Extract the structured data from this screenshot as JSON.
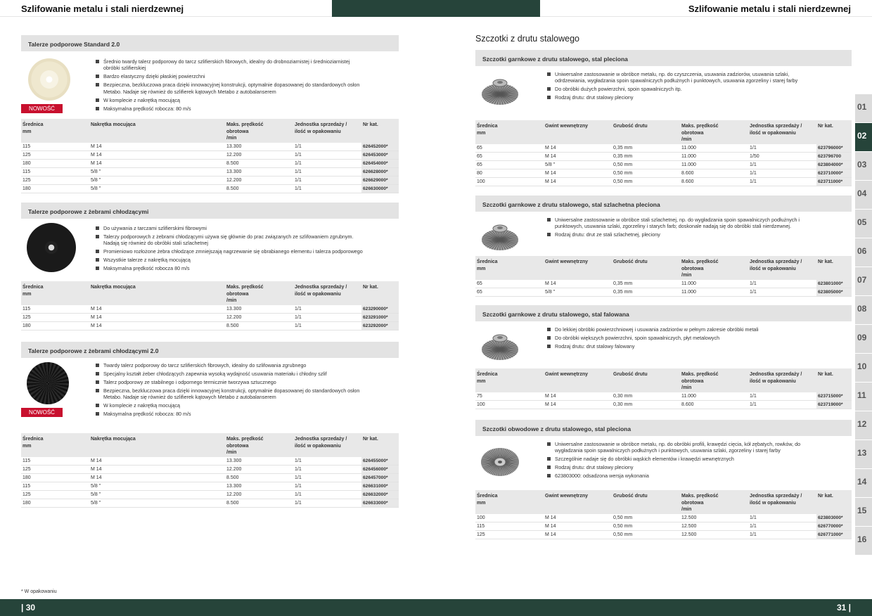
{
  "header": {
    "left_title": "Szlifowanie metalu i stali nierdzewnej",
    "right_title": "Szlifowanie metalu i stali nierdzewnej"
  },
  "badge": "NOWOŚĆ",
  "left_cols": [
    "Średnica\nmm",
    "Nakrętka mocująca",
    "Maks. prędkość\nobrotowa\n/min",
    "Jednostka sprzedaży /\nilość w opakowaniu",
    "Nr kat."
  ],
  "right_cols": [
    "Średnica\nmm",
    "Gwint wewnętrzny",
    "Grubość drutu",
    "Maks. prędkość\nobrotowa\n/min",
    "Jednostka sprzedaży /\nilość w opakowaniu",
    "Nr kat."
  ],
  "left_sections": [
    {
      "title": "Talerze podporowe Standard 2.0",
      "bullets": [
        "Średnio twardy talerz podporowy do tarcz szlifierskich fibrowych, idealny do drobnoziarnistej i średnioziarnistej obróbki szlifierskiej",
        "Bardzo elastyczny dzięki płaskiej powierzchni",
        "Bezpieczna, bezkluczowa praca dzięki innowacyjnej konstrukcji, optymalnie dopasowanej do standardowych osłon Metabo. Nadaje się również do szlifierek kątowych Metabo z autobalanserem",
        "W komplecie z nakrętką mocującą",
        "Maksymalna prędkość robocza: 80 m/s"
      ],
      "rows": [
        [
          "115",
          "M 14",
          "13.300",
          "1/1",
          "626452000*"
        ],
        [
          "125",
          "M 14",
          "12.200",
          "1/1",
          "626453000*"
        ],
        [
          "180",
          "M 14",
          "8.500",
          "1/1",
          "626454000*"
        ],
        [
          "115",
          "5/8 \"",
          "13.300",
          "1/1",
          "626628000*"
        ],
        [
          "125",
          "5/8 \"",
          "12.200",
          "1/1",
          "626629000*"
        ],
        [
          "180",
          "5/8 \"",
          "8.500",
          "1/1",
          "626630000*"
        ]
      ]
    },
    {
      "title": "Talerze podporowe z żebrami chłodzącymi",
      "bullets": [
        "Do używania z tarczami szlifierskimi fibrowymi",
        "Talerzy podporowych z żebrami chłodzącymi używa się głównie do prac związanych ze szlifowaniem zgrubnym. Nadają się również do obróbki stali szlachetnej",
        "Promieniowo rozłożone żebra chłodzące zmniejszają nagrzewanie się obrabianego elementu i talerza podporowego",
        "Wszystkie talerze z nakrętką mocującą",
        "Maksymalna prędkość robocza 80 m/s"
      ],
      "rows": [
        [
          "115",
          "M 14",
          "13.300",
          "1/1",
          "623290000*"
        ],
        [
          "125",
          "M 14",
          "12.200",
          "1/1",
          "623291000*"
        ],
        [
          "180",
          "M 14",
          "8.500",
          "1/1",
          "623292000*"
        ]
      ]
    },
    {
      "title": "Talerze podporowe z żebrami chłodzącymi 2.0",
      "bullets": [
        "Twardy talerz podporowy do tarcz szlifierskich fibrowych, idealny do szlifowania zgrubnego",
        "Specjalny kształt żeber chłodzących zapewnia wysoką wydajność usuwania materiału i chłodny szlif",
        "Talerz podporowy ze stabilnego i odpornego termicznie tworzywa sztucznego",
        "Bezpieczna, bezkluczowa praca dzięki innowacyjnej konstrukcji, optymalnie dopasowanej do standardowych osłon Metabo. Nadaje się również do szlifierek kątowych Metabo z autobalanserem",
        "W komplecie z nakrętką mocującą",
        "Maksymalna prędkość robocza: 80 m/s"
      ],
      "rows": [
        [
          "115",
          "M 14",
          "13.300",
          "1/1",
          "626455000*"
        ],
        [
          "125",
          "M 14",
          "12.200",
          "1/1",
          "626456000*"
        ],
        [
          "180",
          "M 14",
          "8.500",
          "1/1",
          "626457000*"
        ],
        [
          "115",
          "5/8 \"",
          "13.300",
          "1/1",
          "626631000*"
        ],
        [
          "125",
          "5/8 \"",
          "12.200",
          "1/1",
          "626632000*"
        ],
        [
          "180",
          "5/8 \"",
          "8.500",
          "1/1",
          "626633000*"
        ]
      ]
    }
  ],
  "right_title": "Szczotki z drutu stalowego",
  "right_sections": [
    {
      "title": "Szczotki garnkowe z drutu stalowego, stal pleciona",
      "bullets": [
        "Uniwersalne zastosowanie w obróbce metalu, np. do czyszczenia, usuwania zadziorów, usuwania szlaki, odrdzewiania, wygładzania spoin spawalniczych podłużnych i punktowych, usuwania zgorzeliny i starej farby",
        "Do obróbki dużych powierzchni, spoin spawalniczych itp.",
        "Rodzaj drutu: drut stalowy pleciony"
      ],
      "rows": [
        [
          "65",
          "M 14",
          "0,35 mm",
          "11.000",
          "1/1",
          "623796000*"
        ],
        [
          "65",
          "M 14",
          "0,35 mm",
          "11.000",
          "1/50",
          "623796700"
        ],
        [
          "65",
          "5/8 \"",
          "0,50 mm",
          "11.000",
          "1/1",
          "623804000*"
        ],
        [
          "80",
          "M 14",
          "0,50 mm",
          "8.600",
          "1/1",
          "623710000*"
        ],
        [
          "100",
          "M 14",
          "0,50 mm",
          "8.600",
          "1/1",
          "623711000*"
        ]
      ]
    },
    {
      "title": "Szczotki garnkowe z drutu stalowego, stal szlachetna pleciona",
      "bullets": [
        "Uniwersalne zastosowanie w obróbce stali szlachetnej, np. do wygładzania spoin spawalniczych podłużnych i punktowych, usuwania szlaki, zgorzeliny i starych farb; doskonale nadają się do obróbki stali nierdzewnej.",
        "Rodzaj drutu: drut ze stali szlachetnej, pleciony"
      ],
      "rows": [
        [
          "65",
          "M 14",
          "0,35 mm",
          "11.000",
          "1/1",
          "623801000*"
        ],
        [
          "65",
          "5/8 \"",
          "0,35 mm",
          "11.000",
          "1/1",
          "623805000*"
        ]
      ]
    },
    {
      "title": "Szczotki garnkowe z drutu stalowego, stal falowana",
      "bullets": [
        "Do lekkiej obróbki powierzchniowej i usuwania zadziorów w pełnym zakresie obróbki metali",
        "Do obróbki większych powierzchni, spoin spawalniczych, płyt metalowych",
        "Rodzaj drutu: drut stalowy falowany"
      ],
      "rows": [
        [
          "75",
          "M 14",
          "0,30 mm",
          "11.000",
          "1/1",
          "623715000*"
        ],
        [
          "100",
          "M 14",
          "0,30 mm",
          "8.600",
          "1/1",
          "623719000*"
        ]
      ]
    },
    {
      "title": "Szczotki obwodowe z drutu stalowego, stal pleciona",
      "bullets": [
        "Uniwersalne zastosowanie w obróbce metalu, np. do obróbki profili, krawędzi cięcia, kół zębatych, rowków, do wygładzania spoin spawalniczych podłużnych i punktowych, usuwania szlaki, zgorzeliny i starej farby",
        "Szczególnie nadaje się do obróbki wąskich elementów i krawędzi wewnętrznych",
        "Rodzaj drutu: drut stalowy pleciony",
        "623803000: odsadzona wersja wykonania"
      ],
      "rows": [
        [
          "100",
          "M 14",
          "0,50 mm",
          "12.500",
          "1/1",
          "623803000*"
        ],
        [
          "115",
          "M 14",
          "0,50 mm",
          "12.500",
          "1/1",
          "626770000*"
        ],
        [
          "125",
          "M 14",
          "0,50 mm",
          "12.500",
          "1/1",
          "626771000*"
        ]
      ]
    }
  ],
  "tabs": [
    "01",
    "02",
    "03",
    "04",
    "05",
    "06",
    "07",
    "08",
    "09",
    "10",
    "11",
    "12",
    "13",
    "14",
    "15",
    "16"
  ],
  "active_tab": "02",
  "footnote": "* W opakowaniu",
  "page_left": "| 30",
  "page_right": "31 |"
}
